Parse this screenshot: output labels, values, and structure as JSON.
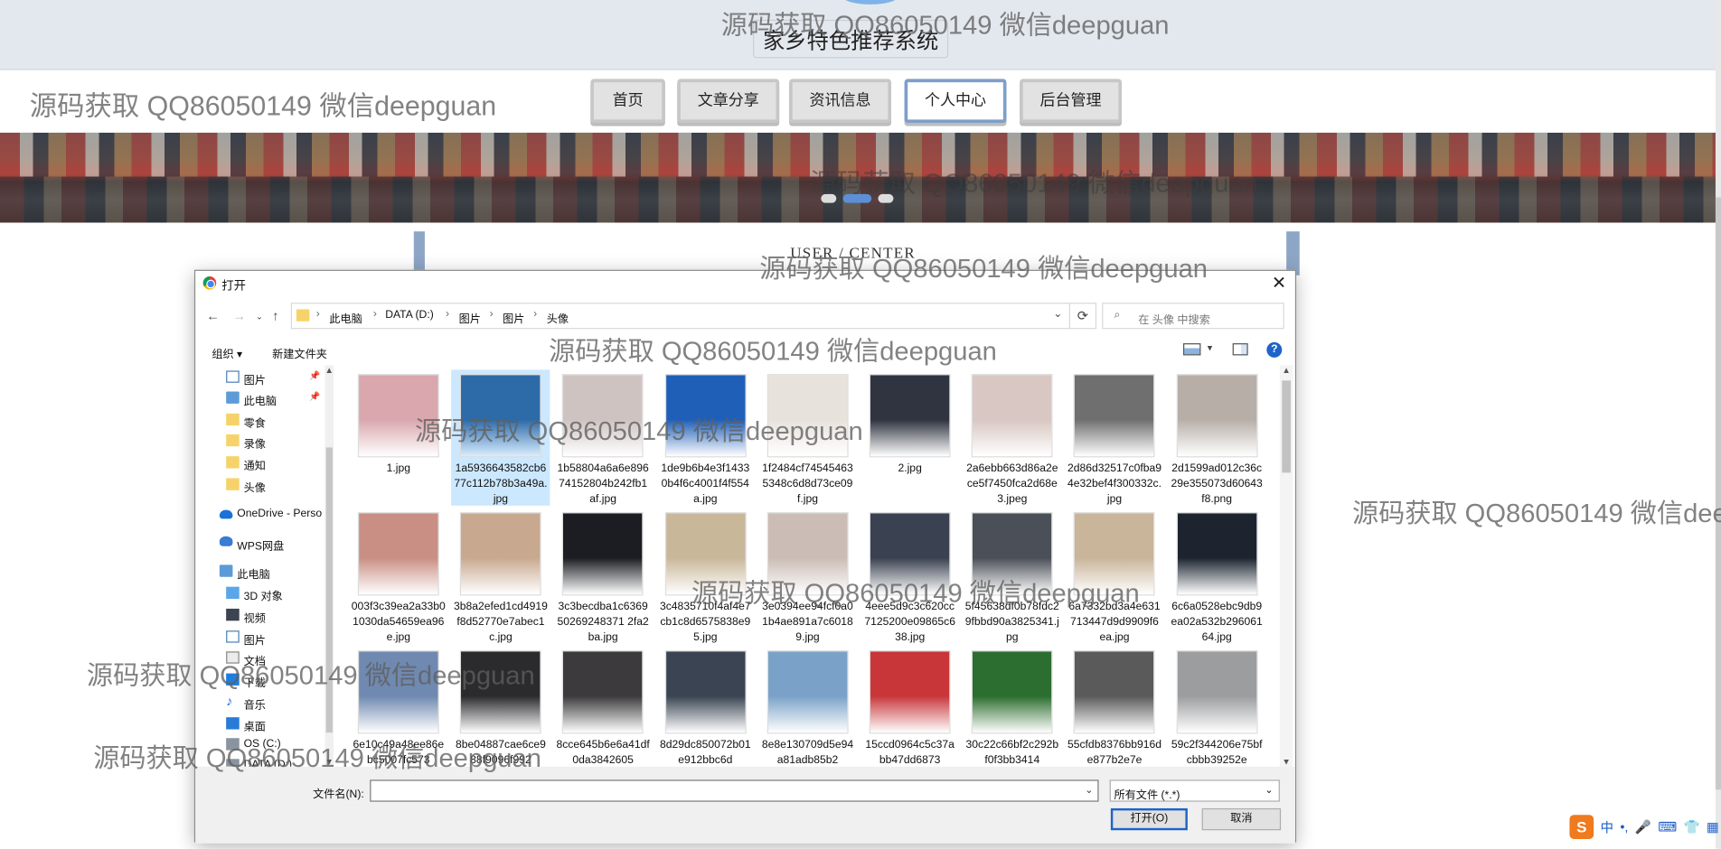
{
  "site": {
    "title": "家乡特色推荐系统",
    "nav": [
      "首页",
      "文章分享",
      "资讯信息",
      "个人中心",
      "后台管理"
    ],
    "active_nav": "个人中心",
    "section_title": "USER / CENTER"
  },
  "watermark": "源码获取 QQ86050149 微信deepguan",
  "dialog": {
    "title": "打开",
    "close": "✕",
    "breadcrumb": [
      "此电脑",
      "DATA (D:)",
      "图片",
      "图片",
      "头像"
    ],
    "search_placeholder": "在 头像 中搜索",
    "toolbar": {
      "organize": "组织 ▾",
      "new_folder": "新建文件夹",
      "help": "?"
    },
    "nav_items": [
      {
        "label": "图片",
        "icon": "pictures-icon",
        "pinned": true
      },
      {
        "label": "此电脑",
        "icon": "computer-icon",
        "pinned": true
      },
      {
        "label": "零食",
        "icon": "folder-icon"
      },
      {
        "label": "录像",
        "icon": "folder-icon"
      },
      {
        "label": "通知",
        "icon": "folder-icon"
      },
      {
        "label": "头像",
        "icon": "folder-icon"
      },
      {
        "label": "OneDrive - Perso",
        "icon": "onedrive-icon"
      },
      {
        "label": "WPS网盘",
        "icon": "wps-cloud-icon"
      },
      {
        "label": "此电脑",
        "icon": "computer-icon"
      },
      {
        "label": "3D 对象",
        "icon": "3d-objects-icon"
      },
      {
        "label": "视频",
        "icon": "videos-icon"
      },
      {
        "label": "图片",
        "icon": "pictures-icon"
      },
      {
        "label": "文档",
        "icon": "documents-icon"
      },
      {
        "label": "下载",
        "icon": "downloads-icon"
      },
      {
        "label": "音乐",
        "icon": "music-icon"
      },
      {
        "label": "桌面",
        "icon": "desktop-icon"
      },
      {
        "label": "OS (C:)",
        "icon": "drive-icon"
      },
      {
        "label": "DATA (D:)",
        "icon": "drive-icon"
      }
    ],
    "files": [
      {
        "name": "1.jpg",
        "color": "#d9a7ad"
      },
      {
        "name": "1a5936643582cb677c112b78b3a49a.jpg",
        "color": "#2d6aa8",
        "selected": true
      },
      {
        "name": "1b58804a6a6e89674152804b242fb1af.jpg",
        "color": "#cfc3c1"
      },
      {
        "name": "1de9b6b4e3f14330b4f6c4001f4f554a.jpg",
        "color": "#1f5fb8"
      },
      {
        "name": "1f2484cf745454635348c6d8d73ce09f.jpg",
        "color": "#e8e2dc"
      },
      {
        "name": "2.jpg",
        "color": "#2f3440"
      },
      {
        "name": "2a6ebb663d86a2ece5f7450fca2d68e3.jpeg",
        "color": "#d8c7c2"
      },
      {
        "name": "2d86d32517c0fba94e32bef4f300332c.jpg",
        "color": "#6f6f6f"
      },
      {
        "name": "2d1599ad012c36c29e355073d60643f8.png",
        "color": "#b8aea8"
      },
      {
        "name": "003f3c39ea2a33b01030da54659ea96e.jpg",
        "color": "#c98f84"
      },
      {
        "name": "3b8a2efed1cd4919f8d52770e7abec1c.jpg",
        "color": "#c8a98f"
      },
      {
        "name": "3c3becdba1c636950269248371 2fa2ba.jpg",
        "color": "#1b1d22"
      },
      {
        "name": "3c4835710f4af4e7cb1c8d6575838e95.jpg",
        "color": "#c9b79a"
      },
      {
        "name": "3e0394ee94fcf0a01b4ae891a7c60189.jpg",
        "color": "#cbbcb6"
      },
      {
        "name": "4eee5d9c3c620cc7125200e09865c638.jpg",
        "color": "#3a4150"
      },
      {
        "name": "5f45638df0b78fdc29fbbd90a3825341.jpg",
        "color": "#4b5058"
      },
      {
        "name": "6a7332bd3a4e631713447d9d9909f6ea.jpg",
        "color": "#c9b59a"
      },
      {
        "name": "6c6a0528ebc9db9ea02a532b29606164.jpg",
        "color": "#1d2430"
      },
      {
        "name": "6e10c49a48ee86ebc5007fc573",
        "color": "#6f89b0"
      },
      {
        "name": "8be04887cae6ce988f9096f992",
        "color": "#2b2b2e"
      },
      {
        "name": "8cce645b6e6a41df0da3842605",
        "color": "#3c3a3c"
      },
      {
        "name": "8d29dc850072b01e912bbc6d",
        "color": "#3a4452"
      },
      {
        "name": "8e8e130709d5e94a81adb85b2",
        "color": "#7aa2c8"
      },
      {
        "name": "15ccd0964c5c37abb47dd6873",
        "color": "#c8363a"
      },
      {
        "name": "30c22c66bf2c292bf0f3bb3414",
        "color": "#2c6e2f"
      },
      {
        "name": "55cfdb8376bb916de877b2e7e",
        "color": "#5a5a5a"
      },
      {
        "name": "59c2f344206e75bfcbbb39252e",
        "color": "#9b9d9f"
      }
    ],
    "filename_label": "文件名(N):",
    "filename_value": "",
    "filetype": "所有文件 (*.*)",
    "open_button": "打开(O)",
    "cancel_button": "取消"
  },
  "tray": {
    "ime": "中",
    "punct": "•,",
    "mic": "🎤",
    "keyboard": "⌨",
    "skin": "👕",
    "grid": "▦"
  }
}
